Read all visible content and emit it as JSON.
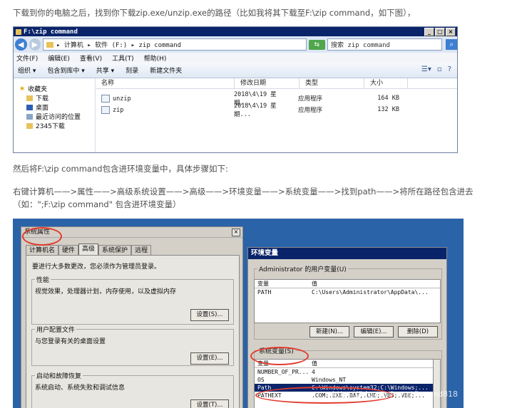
{
  "intro_text": "下载到你的电脑之后，找到你下载zip.exe/unzip.exe的路径（比如我将其下载至F:\\zip command，如下图），",
  "explorer": {
    "title": "F:\\zip command",
    "breadcrumb": "▸ 计算机 ▸ 软件 (F:) ▸ zip command",
    "search_placeholder": "搜索 zip command",
    "menu": [
      "文件(F)",
      "编辑(E)",
      "查看(V)",
      "工具(T)",
      "帮助(H)"
    ],
    "toolbar": [
      "组织 ▾",
      "包含到库中 ▾",
      "共享 ▾",
      "刻录",
      "新建文件夹"
    ],
    "nav": {
      "favorites": "收藏夹",
      "items": [
        "下载",
        "桌面",
        "最近访问的位置",
        "2345下载"
      ]
    },
    "columns": [
      "名称",
      "修改日期",
      "类型",
      "大小"
    ],
    "files": [
      {
        "name": "unzip",
        "date": "2018\\4\\19 星期...",
        "type": "应用程序",
        "size": "164 KB"
      },
      {
        "name": "zip",
        "date": "2018\\4\\19 星期...",
        "type": "应用程序",
        "size": "132 KB"
      }
    ]
  },
  "para2": "然后将F:\\zip command包含进环境变量中，具体步骤如下:",
  "para3_line1": "右键计算机——>属性——>高级系统设置——>高级——>环境变量——>系统变量——>找到path——>将所在路径包含进去",
  "para3_line2": "（如：\";F:\\zip command\" 包含进环境变量）",
  "sysprops": {
    "title": "系统属性",
    "tabs": [
      "计算机名",
      "硬件",
      "高级",
      "系统保护",
      "远程"
    ],
    "admin_note": "要进行大多数更改，您必须作为管理员登录。",
    "perf_label": "性能",
    "perf_desc": "视觉效果，处理器计划，内存使用，以及虚拟内存",
    "perf_btn": "设置(S)...",
    "profile_label": "用户配置文件",
    "profile_desc": "与您登录有关的桌面设置",
    "profile_btn": "设置(E)...",
    "startup_label": "启动和故障恢复",
    "startup_desc": "系统启动、系统失败和调试信息",
    "startup_btn": "设置(T)..."
  },
  "envvars": {
    "title": "环境变量",
    "user_group": "Administrator 的用户变量(U)",
    "col_var": "变量",
    "col_val": "值",
    "user_rows": [
      {
        "var": "PATH",
        "val": "C:\\Users\\Administrator\\AppData\\..."
      }
    ],
    "btn_new": "新建(N)...",
    "btn_edit": "编辑(E)...",
    "btn_delete": "删除(D)",
    "sys_group": "系统变量(S)",
    "sys_rows": [
      {
        "var": "NUMBER_OF_PR...",
        "val": "4"
      },
      {
        "var": "OS",
        "val": "Windows_NT"
      },
      {
        "var": "Path",
        "val": "C:\\Windows\\system32;C:\\Windows;..."
      },
      {
        "var": "PATHEXT",
        "val": ".COM;.EXE;.BAT;.CMD;.VBS;.VBE;..."
      }
    ]
  },
  "watermark": "https://blog.csdn.net/legend818"
}
